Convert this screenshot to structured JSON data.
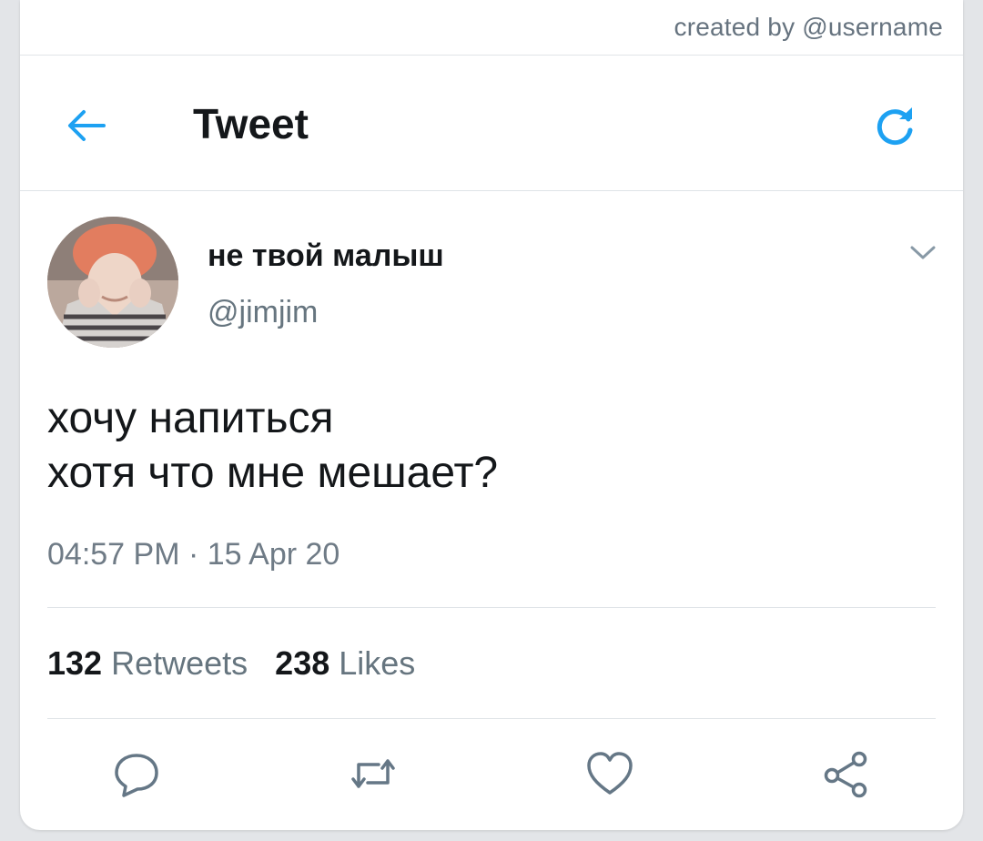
{
  "credit": {
    "text": "created by @username"
  },
  "header": {
    "title": "Tweet",
    "back_icon": "back-arrow-icon",
    "refresh_icon": "refresh-icon",
    "accent": "#1da1f2"
  },
  "tweet": {
    "display_name": "не твой малыш",
    "handle": "@jimjim",
    "lines": [
      "хочу напиться",
      "хотя что мне мешает?"
    ],
    "time": "04:57 PM",
    "separator": "·",
    "date": "15 Apr 20"
  },
  "stats": {
    "retweets_count": "132",
    "retweets_label": "Retweets",
    "likes_count": "238",
    "likes_label": "Likes"
  },
  "actions": {
    "icons": [
      "reply-icon",
      "retweet-icon",
      "like-icon",
      "share-icon"
    ],
    "color": "#657786"
  }
}
